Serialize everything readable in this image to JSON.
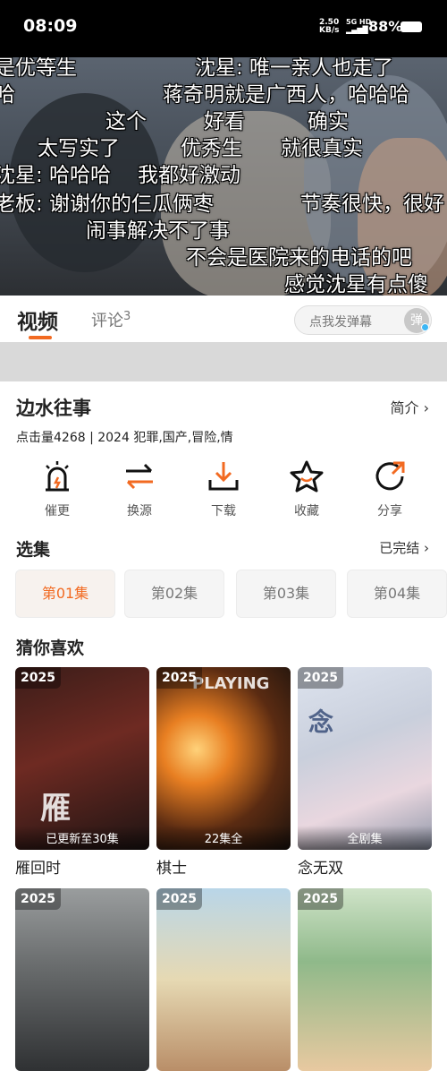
{
  "status": {
    "time": "08:09",
    "net_rate": "2.50",
    "net_unit": "KB/s",
    "net_type": "5G HD",
    "battery": "88%"
  },
  "danmaku": [
    "是优等生",
    "沈星: 唯一亲人也走了",
    "哈",
    "蒋奇明就是广西人，哈哈哈",
    "这个",
    "好看",
    "确实",
    "太写实了",
    "优秀生",
    "就很真实",
    "沈星: 哈哈哈",
    "我都好激动",
    "老板: 谢谢你的仨瓜俩枣",
    "节奏很快，很好",
    "闹事解决不了事",
    "不会是医院来的电话的吧",
    "感觉沈星有点傻"
  ],
  "tabs": {
    "video": "视频",
    "comment": "评论",
    "comment_count": "3"
  },
  "danmu_input": {
    "placeholder": "点我发弹幕",
    "toggle": "弹"
  },
  "show": {
    "title": "边水往事",
    "intro_label": "简介",
    "meta": "点击量4268 | 2024 犯罪,国产,冒险,情"
  },
  "actions": [
    {
      "label": "催更",
      "icon": "alarm-icon"
    },
    {
      "label": "换源",
      "icon": "swap-icon"
    },
    {
      "label": "下载",
      "icon": "download-icon"
    },
    {
      "label": "收藏",
      "icon": "star-icon"
    },
    {
      "label": "分享",
      "icon": "share-icon"
    }
  ],
  "episodes": {
    "title": "选集",
    "status": "已完结",
    "items": [
      "第01集",
      "第02集",
      "第03集",
      "第04集"
    ],
    "active_index": 0
  },
  "recommend": {
    "title": "猜你喜欢",
    "items": [
      {
        "name": "雁回时",
        "year": "2025",
        "badge": "已更新至30集"
      },
      {
        "name": "棋士",
        "year": "2025",
        "badge": "22集全"
      },
      {
        "name": "念无双",
        "year": "2025",
        "badge": "全剧集"
      },
      {
        "name": "",
        "year": "2025",
        "badge": ""
      },
      {
        "name": "",
        "year": "2025",
        "badge": ""
      },
      {
        "name": "",
        "year": "2025",
        "badge": ""
      }
    ]
  },
  "colors": {
    "accent": "#f26a21",
    "dark_icon": "#111111"
  }
}
